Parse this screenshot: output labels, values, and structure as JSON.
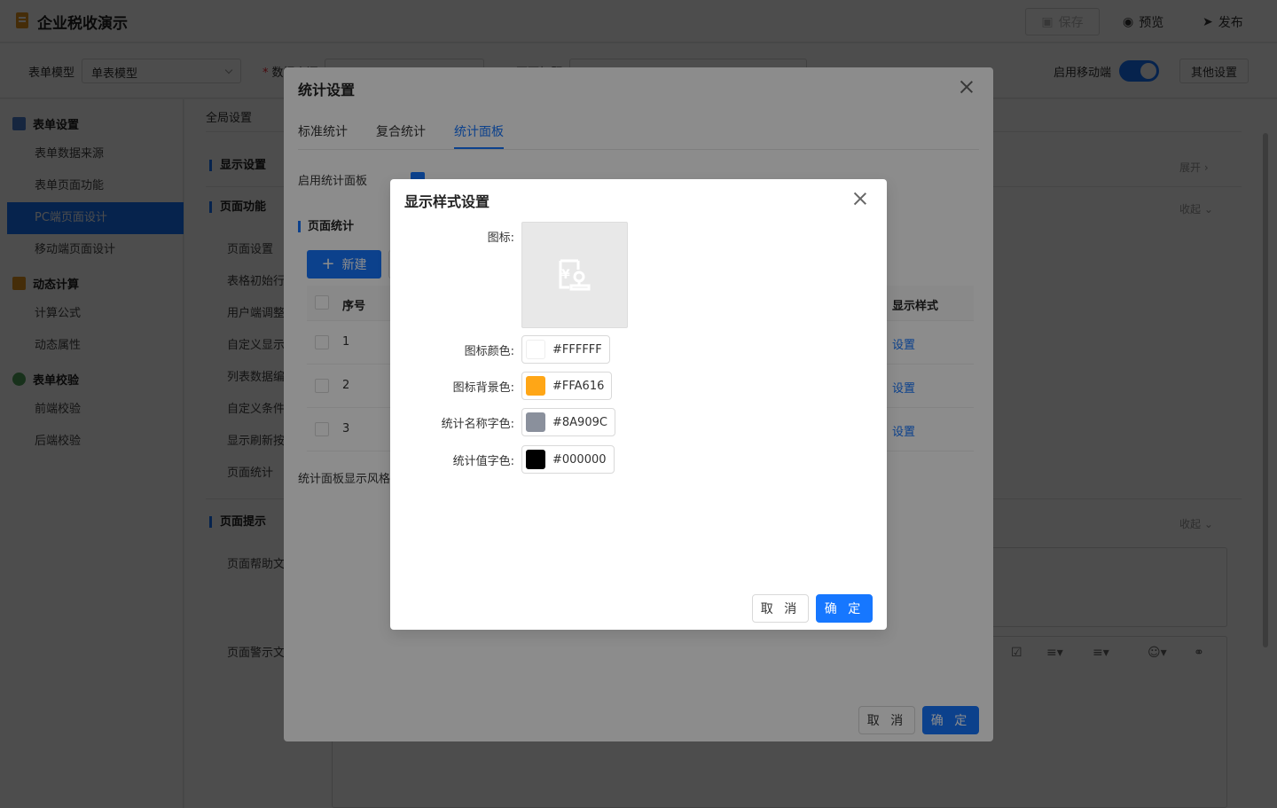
{
  "app": {
    "title": "企业税收演示"
  },
  "topbar": {
    "save": "保存",
    "preview": "预览",
    "publish": "发布"
  },
  "subbar": {
    "model_label": "表单模型",
    "model_value": "单表模型",
    "datasource_label": "数据来源",
    "title_label": "页面标题",
    "mobile_label": "启用移动端",
    "mobile_enabled": true,
    "other_settings": "其他设置"
  },
  "sidebar": {
    "groups": [
      {
        "title": "表单设置",
        "items": [
          "表单数据来源",
          "表单页面功能",
          "PC端页面设计",
          "移动端页面设计"
        ]
      },
      {
        "title": "动态计算",
        "items": [
          "计算公式",
          "动态属性"
        ]
      },
      {
        "title": "表单校验",
        "items": [
          "前端校验",
          "后端校验"
        ]
      }
    ],
    "active_item": "PC端页面设计"
  },
  "content": {
    "tab_global": "全局设置",
    "sec_display": "显示设置",
    "expand": "展开",
    "sec_function": "页面功能",
    "collapse": "收起",
    "function_items": [
      "页面设置",
      "表格初始行",
      "用户端调整",
      "自定义显示",
      "列表数据编",
      "自定义条件",
      "显示刷新按",
      "页面统计"
    ],
    "sec_hint": "页面提示",
    "hint_items": [
      "页面帮助文",
      "页面警示文"
    ]
  },
  "stats_modal": {
    "title": "统计设置",
    "tabs": [
      "标准统计",
      "复合统计",
      "统计面板"
    ],
    "active_tab": "统计面板",
    "enable_label": "启用统计面板",
    "enabled": true,
    "section": "页面统计",
    "new_button": "新建",
    "columns": [
      "序号",
      "显示样式"
    ],
    "rows": [
      {
        "no": "1",
        "action": "设置"
      },
      {
        "no": "2",
        "action": "设置"
      },
      {
        "no": "3",
        "action": "设置"
      }
    ],
    "style_label": "统计面板显示风格",
    "cancel": "取 消",
    "ok": "确 定"
  },
  "style_modal": {
    "title": "显示样式设置",
    "icon_label": "图标:",
    "icon_name": "tax-yuan-icon",
    "fields": [
      {
        "label": "图标颜色:",
        "value": "#FFFFFF",
        "color": "#FFFFFF"
      },
      {
        "label": "图标背景色:",
        "value": "#FFA616",
        "color": "#FFA616"
      },
      {
        "label": "统计名称字色:",
        "value": "#8A909C",
        "color": "#8A909C"
      },
      {
        "label": "统计值字色:",
        "value": "#000000",
        "color": "#000000"
      }
    ],
    "cancel": "取 消",
    "ok": "确 定"
  },
  "colors": {
    "primary": "#1677ff",
    "mask": "rgba(0,0,0,0.45)"
  }
}
